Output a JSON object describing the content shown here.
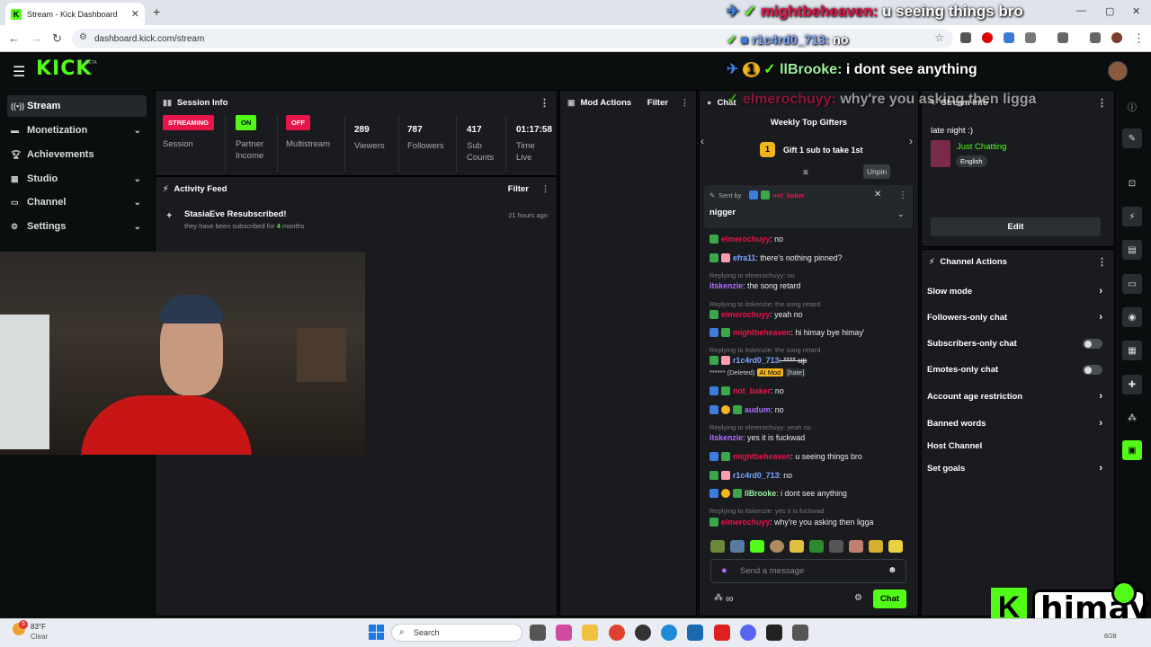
{
  "browser": {
    "tab_title": "Stream - Kick Dashboard",
    "url": "dashboard.kick.com/stream",
    "new_tab": "+"
  },
  "kick": {
    "logo": "KICK",
    "beta": "BETA"
  },
  "sidebar": {
    "items": [
      {
        "label": "Stream",
        "icon": "broadcast-icon",
        "chev": ""
      },
      {
        "label": "Monetization",
        "icon": "money-icon",
        "chev": "⌄"
      },
      {
        "label": "Achievements",
        "icon": "trophy-icon",
        "chev": ""
      },
      {
        "label": "Studio",
        "icon": "studio-icon",
        "chev": "⌄"
      },
      {
        "label": "Channel",
        "icon": "channel-icon",
        "chev": "⌄"
      },
      {
        "label": "Settings",
        "icon": "gear-icon",
        "chev": "⌄"
      }
    ]
  },
  "session": {
    "title": "Session Info",
    "streaming": "STREAMING",
    "session_label": "Session",
    "on": "ON",
    "partner1": "Partner",
    "partner2": "Income",
    "off": "OFF",
    "multistream": "Multistream",
    "viewers": "289",
    "viewers_label": "Viewers",
    "followers": "787",
    "followers_label": "Followers",
    "subs": "417",
    "subs_label1": "Sub",
    "subs_label2": "Counts",
    "time": "01:17:58",
    "time_label1": "Time",
    "time_label2": "Live"
  },
  "activity": {
    "title": "Activity Feed",
    "filter": "Filter",
    "event_title": "StasiaEve Resubscribed!",
    "event_desc_pre": "they have been subscribed for ",
    "event_months": "4",
    "event_desc_post": " months",
    "event_time": "21 hours ago"
  },
  "mod": {
    "title": "Mod Actions",
    "filter": "Filter"
  },
  "chat": {
    "title": "Chat",
    "gifters": "Weekly Top Gifters",
    "gift_rank": "1",
    "gift_text": "Gift 1 sub to take 1st",
    "unpin": "Unpin",
    "pinned_sent_by": "Sent by",
    "pinned_user": "not_baker",
    "pinned_msg": "nigger",
    "lines": [
      {
        "reply": "",
        "user": "elmerochuyy",
        "text": ": no"
      },
      {
        "reply": "",
        "user": "efra11",
        "text": ": there's nothing pinned?"
      },
      {
        "reply": "Replying to elmerochuyy: no",
        "user": "itskenzie",
        "text": ": the song retard"
      },
      {
        "reply": "Replying to itskenzie: the song retard",
        "user": "elmerochuyy",
        "text": ": yeah no"
      },
      {
        "reply": "",
        "user": "mightbeheaven",
        "text": ": hi himay bye himay'"
      },
      {
        "reply": "Replying to itskenzie: the song retard",
        "user": "r1c4rd0_713",
        "text": ": **** up"
      },
      {
        "reply": "",
        "user": "",
        "text": "****** (Deleted)"
      },
      {
        "reply": "",
        "user": "not_baker",
        "text": ": no"
      },
      {
        "reply": "",
        "user": "audum",
        "text": ": no"
      },
      {
        "reply": "Replying to elmerochuyy: yeah no",
        "user": "itskenzie",
        "text": ": yes it is fuckwad"
      },
      {
        "reply": "",
        "user": "mightbeheaven",
        "text": ": u seeing things bro"
      },
      {
        "reply": "",
        "user": "r1c4rd0_713",
        "text": ": no"
      },
      {
        "reply": "",
        "user": "llBrooke",
        "text": ": i dont see anything"
      },
      {
        "reply": "Replying to itskenzie: yes it is fuckwad",
        "user": "elmerochuyy",
        "text": ": why're you asking then ligga"
      }
    ],
    "ai_mod": "AI Mod",
    "hate": "[hate]",
    "input_placeholder": "Send a message",
    "chat_button": "Chat",
    "infinity": "∞"
  },
  "stream_info": {
    "title": "Stream Info",
    "stream_title": "late night :)",
    "category": "Just Chatting",
    "language": "English",
    "edit": "Edit"
  },
  "channel_actions": {
    "title": "Channel Actions",
    "items": [
      "Slow mode",
      "Followers-only chat",
      "Subscribers-only chat",
      "Emotes-only chat",
      "Account age restriction",
      "Banned words",
      "Host Channel",
      "Set goals"
    ]
  },
  "overlay": {
    "line1_user": "mightbeheaven:",
    "line1_msg": " u seeing things bro",
    "line2_user": "r1c4rd0_713:",
    "line2_msg": " no",
    "line3_badge": "1",
    "line3_user": "llBrooke:",
    "line3_msg": " i dont see anything",
    "line4_user": "elmerochuyy:",
    "line4_msg": " why're you asking then ligga",
    "brand": "himay"
  },
  "taskbar": {
    "weather_temp": "83°F",
    "weather_desc": "Clear",
    "search": "Search",
    "badge": "5",
    "date": "8/28"
  },
  "colors": {
    "kick_green": "#53fc18",
    "streaming_red": "#e8154b",
    "panel": "#191b1f"
  }
}
